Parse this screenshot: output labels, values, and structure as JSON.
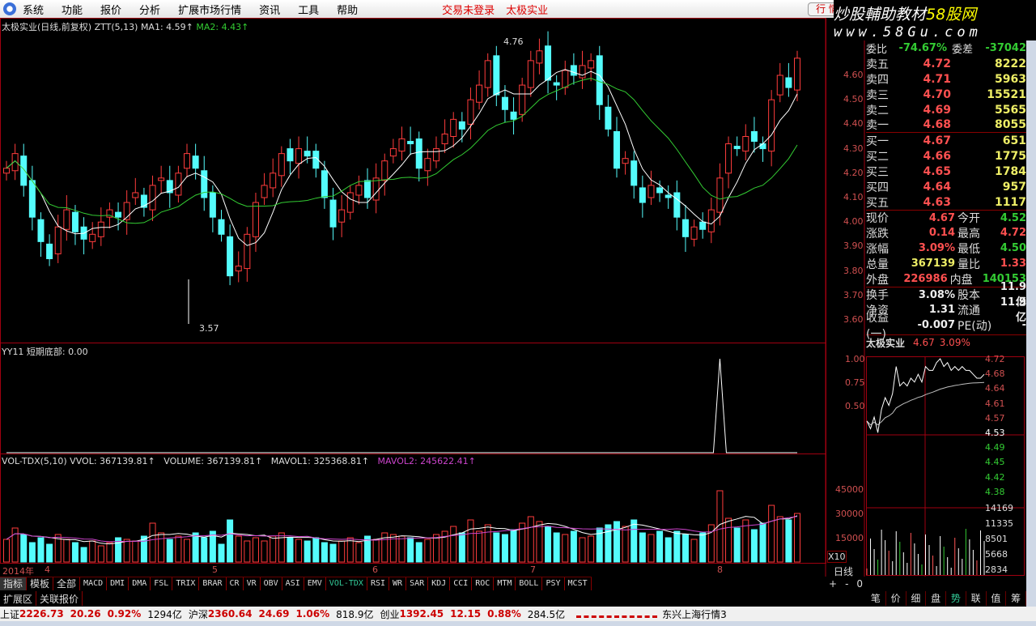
{
  "menu": {
    "items": [
      "系统",
      "功能",
      "报价",
      "分析",
      "扩展市场行情",
      "资讯",
      "工具",
      "帮助"
    ],
    "status1": "交易未登录",
    "status2": "太极实业",
    "hq_button": "行 情"
  },
  "brand": {
    "line1": "炒股輔助教材",
    "line1b": "58股网",
    "line2": "www.58Gu.com"
  },
  "main_chart": {
    "title": "太极实业(日线,前复权) ZTT(5,13)",
    "ma1": "MA1: 4.59↑",
    "ma2": "MA2: 4.43↑",
    "high_label": "4.76",
    "low_label": "3.57",
    "y_ticks": [
      "4.60",
      "4.50",
      "4.40",
      "4.30",
      "4.20",
      "4.10",
      "4.00",
      "3.90",
      "3.80",
      "3.70",
      "3.60"
    ]
  },
  "indicator": {
    "title": "YY11 短期底部: 0.00",
    "y_ticks": [
      "1.00",
      "0.75",
      "0.50"
    ]
  },
  "volume_panel": {
    "title": "VOL-TDX(5,10) VVOL: 367139.81↑",
    "volume": "VOLUME: 367139.81↑",
    "mavol1": "MAVOL1: 325368.81↑",
    "mavol2": "MAVOL2: 245622.41↑",
    "y_ticks": [
      "45000",
      "30000",
      "15000"
    ],
    "unit": "X10"
  },
  "date_axis": {
    "year": "2014年",
    "months": [
      "4",
      "5",
      "6",
      "7",
      "8"
    ],
    "period": "日线",
    "zoom": [
      "+",
      "-",
      "0"
    ]
  },
  "chart_data": {
    "type": "candlestick",
    "close": [
      4.22,
      4.28,
      4.15,
      4.02,
      3.92,
      3.85,
      3.98,
      4.05,
      3.96,
      3.93,
      3.95,
      4.0,
      4.05,
      4.02,
      4.08,
      4.12,
      4.06,
      4.15,
      4.18,
      4.12,
      4.2,
      4.28,
      4.22,
      4.1,
      4.02,
      3.95,
      3.78,
      3.82,
      3.95,
      4.08,
      4.15,
      4.2,
      4.28,
      4.25,
      4.3,
      4.27,
      4.22,
      4.1,
      3.98,
      4.05,
      4.12,
      4.15,
      4.1,
      4.18,
      4.25,
      4.3,
      4.34,
      4.32,
      4.22,
      4.26,
      4.3,
      4.36,
      4.42,
      4.38,
      4.5,
      4.56,
      4.66,
      4.52,
      4.46,
      4.42,
      4.56,
      4.66,
      4.7,
      4.58,
      4.56,
      4.62,
      4.6,
      4.64,
      4.66,
      4.48,
      4.38,
      4.22,
      4.26,
      4.15,
      4.08,
      4.15,
      4.12,
      4.1,
      4.02,
      3.94,
      3.98,
      3.97,
      4.05,
      4.18,
      4.32,
      4.3,
      4.35,
      4.33,
      4.3,
      4.5,
      4.6,
      4.55,
      4.67
    ],
    "volume": [
      14000,
      21000,
      17000,
      12000,
      15000,
      11000,
      17000,
      14000,
      12000,
      9000,
      13000,
      10000,
      12000,
      15000,
      14000,
      13000,
      16000,
      24000,
      18000,
      14000,
      16000,
      14000,
      18000,
      15000,
      19000,
      11000,
      26000,
      16000,
      13000,
      15000,
      13000,
      16000,
      18000,
      15000,
      14000,
      13000,
      15000,
      12000,
      11000,
      13000,
      15000,
      12000,
      16000,
      14000,
      18000,
      17000,
      16000,
      15000,
      12000,
      14000,
      17000,
      19000,
      22000,
      18000,
      26000,
      19000,
      23000,
      18000,
      17000,
      20000,
      24000,
      28000,
      25000,
      22000,
      18000,
      17000,
      19000,
      15000,
      16000,
      21000,
      23000,
      25000,
      22000,
      26000,
      18000,
      17000,
      19000,
      15000,
      19000,
      17000,
      14000,
      18000,
      23000,
      44000,
      27000,
      21000,
      26000,
      20000,
      24000,
      35000,
      28000,
      26000,
      30000
    ],
    "ma_periods": [
      5,
      13
    ],
    "yy11_signal_index": 83,
    "price_range": [
      3.55,
      4.8
    ]
  },
  "quote": {
    "wb_label": "委比",
    "wb": "-74.67%",
    "wc_label": "委差",
    "wc": "-37042",
    "asks": [
      {
        "l": "卖五",
        "p": "4.72",
        "v": "8222"
      },
      {
        "l": "卖四",
        "p": "4.71",
        "v": "5963"
      },
      {
        "l": "卖三",
        "p": "4.70",
        "v": "15521"
      },
      {
        "l": "卖二",
        "p": "4.69",
        "v": "5565"
      },
      {
        "l": "卖一",
        "p": "4.68",
        "v": "8055"
      }
    ],
    "bids": [
      {
        "l": "买一",
        "p": "4.67",
        "v": "651"
      },
      {
        "l": "买二",
        "p": "4.66",
        "v": "1775"
      },
      {
        "l": "买三",
        "p": "4.65",
        "v": "1784"
      },
      {
        "l": "买四",
        "p": "4.64",
        "v": "957"
      },
      {
        "l": "买五",
        "p": "4.63",
        "v": "1117"
      }
    ],
    "stats": [
      [
        "现价",
        "4.67",
        "今开",
        "4.52"
      ],
      [
        "涨跌",
        "0.14",
        "最高",
        "4.72"
      ],
      [
        "涨幅",
        "3.09%",
        "最低",
        "4.50"
      ],
      [
        "总量",
        "367139",
        "量比",
        "1.33"
      ],
      [
        "外盘",
        "226986",
        "内盘",
        "140153"
      ],
      [
        "换手",
        "3.08%",
        "股本",
        "11.9亿"
      ],
      [
        "净资",
        "1.31",
        "流通",
        "11.9亿"
      ],
      [
        "收益(一)",
        "-0.007",
        "PE(动)",
        "-"
      ]
    ]
  },
  "mini": {
    "name": "太极实业",
    "price": "4.67",
    "pct": "3.09%",
    "y_ticks": [
      "4.72",
      "4.68",
      "4.64",
      "4.61",
      "4.57",
      "4.53",
      "4.49",
      "4.45",
      "4.42",
      "4.38"
    ],
    "v_ticks": [
      "14169",
      "11335",
      "8501",
      "5668",
      "2834"
    ],
    "prices": [
      4.56,
      4.54,
      4.57,
      4.53,
      4.59,
      4.62,
      4.6,
      4.63,
      4.7,
      4.65,
      4.66,
      4.65,
      4.67,
      4.66,
      4.68,
      4.66,
      4.7,
      4.69,
      4.69,
      4.71,
      4.72,
      4.7,
      4.71,
      4.69,
      4.7,
      4.69,
      4.7,
      4.69,
      4.69,
      4.68,
      4.67,
      4.67,
      4.68
    ]
  },
  "tabs": [
    "指标",
    "模板",
    "全部",
    "MACD",
    "DMI",
    "DMA",
    "FSL",
    "TRIX",
    "BRAR",
    "CR",
    "VR",
    "OBV",
    "ASI",
    "EMV",
    "VOL-TDX",
    "RSI",
    "WR",
    "SAR",
    "KDJ",
    "CCI",
    "ROC",
    "MTM",
    "BOLL",
    "PSY",
    "MCST"
  ],
  "ext_tabs": [
    "扩展区",
    "关联报价"
  ],
  "mini_tabs": [
    "笔",
    "价",
    "细",
    "盘",
    "势",
    "联",
    "值",
    "筹"
  ],
  "status": {
    "items": [
      [
        "上证",
        "2226.73",
        "20.26",
        "0.92%",
        "1294亿"
      ],
      [
        "沪深",
        "2360.64",
        "24.69",
        "1.06%",
        "818.9亿"
      ],
      [
        "创业",
        "1392.45",
        "12.15",
        "0.88%",
        "284.5亿"
      ]
    ],
    "server": "东兴上海行情3"
  }
}
